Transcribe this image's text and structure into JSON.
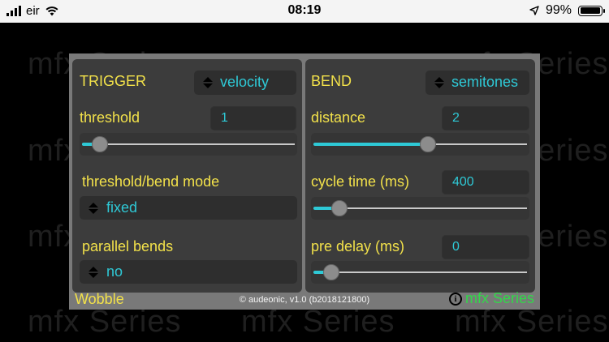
{
  "status_bar": {
    "carrier": "eir",
    "time": "08:19",
    "battery": "99%",
    "icons": [
      "signal-bars-icon",
      "wifi-icon",
      "location-arrow-icon",
      "battery-icon"
    ]
  },
  "background": {
    "watermark_text": "mfx Series"
  },
  "plugin": {
    "trigger": {
      "title": "TRIGGER",
      "mode_value": "velocity",
      "threshold_label": "threshold",
      "threshold_value": "1",
      "threshold_slider": 0.05,
      "bend_mode_label": "threshold/bend mode",
      "bend_mode_value": "fixed",
      "parallel_label": "parallel bends",
      "parallel_value": "no"
    },
    "bend": {
      "title": "BEND",
      "unit_value": "semitones",
      "distance_label": "distance",
      "distance_value": "2",
      "distance_slider": 0.54,
      "cycle_label": "cycle time (ms)",
      "cycle_value": "400",
      "cycle_slider": 0.09,
      "predelay_label": "pre delay (ms)",
      "predelay_value": "0",
      "predelay_slider": 0.05
    },
    "footer": {
      "name": "Wobble",
      "copyright": "© audeonic, v1.0 (b2018121800)",
      "info_symbol": "i",
      "brand": "mfx Series"
    }
  },
  "colors": {
    "label": "#f2e14a",
    "value": "#2ec9d6",
    "brand": "#32d84a",
    "panel": "#797979",
    "column": "#3c3c3c"
  }
}
